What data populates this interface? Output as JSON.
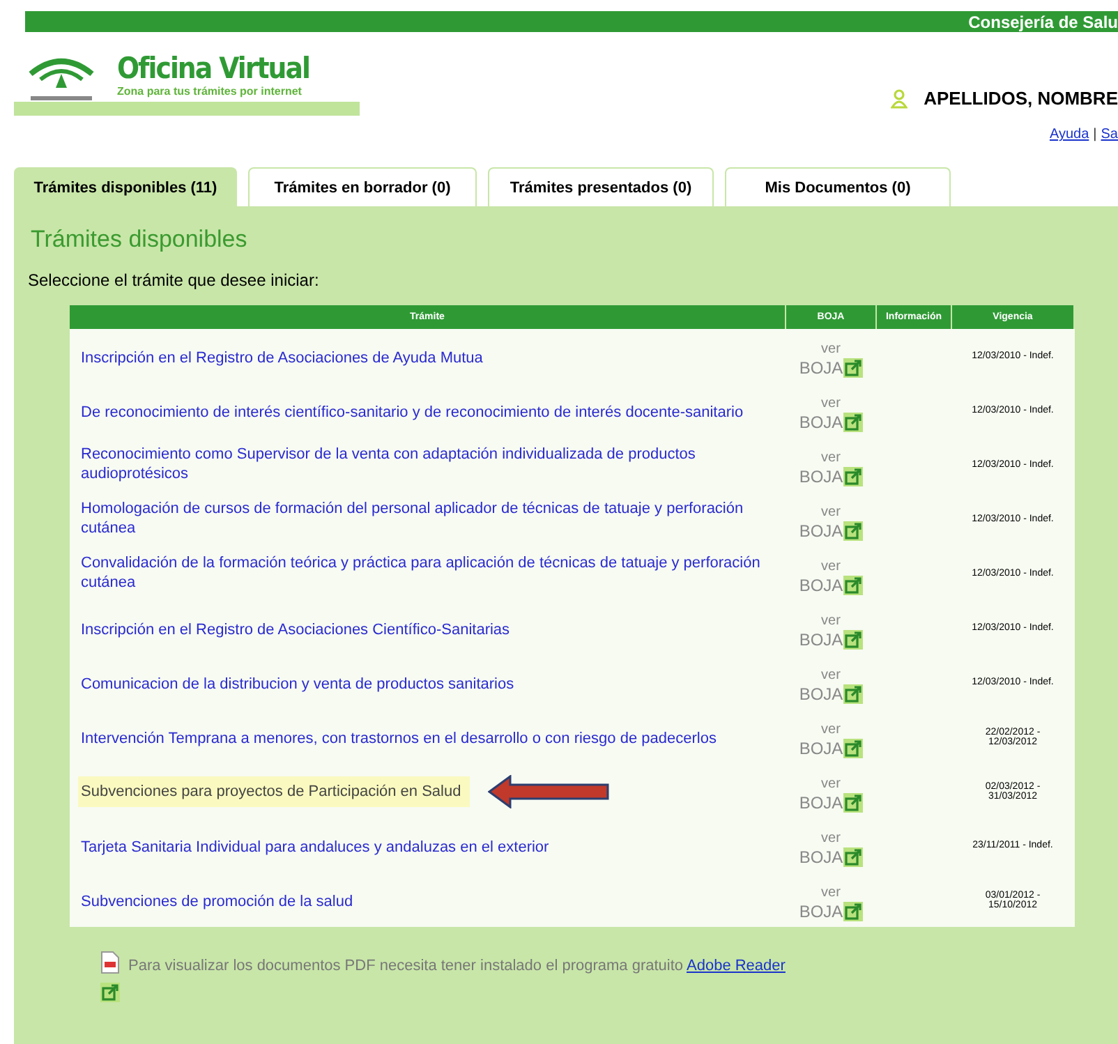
{
  "top_bar": {
    "title": "Consejería de Salu"
  },
  "header": {
    "logo_title": "Oficina Virtual",
    "logo_subtitle": "Zona para tus trámites por internet",
    "user": "APELLIDOS, NOMBRE",
    "links": [
      "Ayuda",
      "Sa"
    ],
    "link_separator": "|"
  },
  "tabs": [
    {
      "label": "Trámites disponibles (11)",
      "selected": true
    },
    {
      "label": "Trámites en borrador (0)",
      "selected": false
    },
    {
      "label": "Trámites presentados (0)",
      "selected": false
    },
    {
      "label": "Mis Documentos (0)",
      "selected": false
    }
  ],
  "section": {
    "title": "Trámites disponibles",
    "instruction": "Seleccione el trámite que desee iniciar:"
  },
  "table": {
    "columns": [
      "Trámite",
      "BOJA",
      "Información",
      "Vigencia"
    ],
    "rows": [
      {
        "tramite": "Inscripción en el Registro de Asociaciones de Ayuda Mutua",
        "boja_top": "ver",
        "boja": "BOJA",
        "vigencia": "12/03/2010 - Indef.",
        "selected": false
      },
      {
        "tramite": "De reconocimiento de interés científico-sanitario y de reconocimiento de interés docente-sanitario",
        "boja_top": "ver",
        "boja": "BOJA",
        "vigencia": "12/03/2010 - Indef.",
        "selected": false
      },
      {
        "tramite": "Reconocimiento como Supervisor de la venta con adaptación individualizada de productos audioprotésicos",
        "boja_top": "ver",
        "boja": "BOJA",
        "vigencia": "12/03/2010 - Indef.",
        "selected": false
      },
      {
        "tramite": "Homologación de cursos de formación del personal aplicador de técnicas de tatuaje y perforación cutánea",
        "boja_top": "ver",
        "boja": "BOJA",
        "vigencia": "12/03/2010 - Indef.",
        "selected": false
      },
      {
        "tramite": "Convalidación de la formación teórica y práctica para aplicación de técnicas de tatuaje y perforación cutánea",
        "boja_top": "ver",
        "boja": "BOJA",
        "vigencia": "12/03/2010 - Indef.",
        "selected": false
      },
      {
        "tramite": "Inscripción en el Registro de Asociaciones Científico-Sanitarias",
        "boja_top": "ver",
        "boja": "BOJA",
        "vigencia": "12/03/2010 - Indef.",
        "selected": false
      },
      {
        "tramite": "Comunicacion de la distribucion y venta de productos sanitarios",
        "boja_top": "ver",
        "boja": "BOJA",
        "vigencia": "12/03/2010 - Indef.",
        "selected": false
      },
      {
        "tramite": "Intervención Temprana a menores, con trastornos en el desarrollo o con riesgo de padecerlos",
        "boja_top": "ver",
        "boja": "BOJA",
        "vigencia": "22/02/2012 - 12/03/2012",
        "selected": false
      },
      {
        "tramite": "Subvenciones para proyectos de Participación en Salud",
        "boja_top": "ver",
        "boja": "BOJA",
        "vigencia": "02/03/2012 - 31/03/2012",
        "selected": true
      },
      {
        "tramite": "Tarjeta Sanitaria Individual para andaluces y andaluzas en el exterior",
        "boja_top": "ver",
        "boja": "BOJA",
        "vigencia": "23/11/2011 - Indef.",
        "selected": false
      },
      {
        "tramite": "Subvenciones de promoción de la salud",
        "boja_top": "ver",
        "boja": "BOJA",
        "vigencia": "03/01/2012 - 15/10/2012",
        "selected": false
      }
    ]
  },
  "footer": {
    "pdf_note": "Para visualizar los documentos PDF necesita tener instalado el programa gratuito",
    "pdf_link": "Adobe Reader"
  }
}
